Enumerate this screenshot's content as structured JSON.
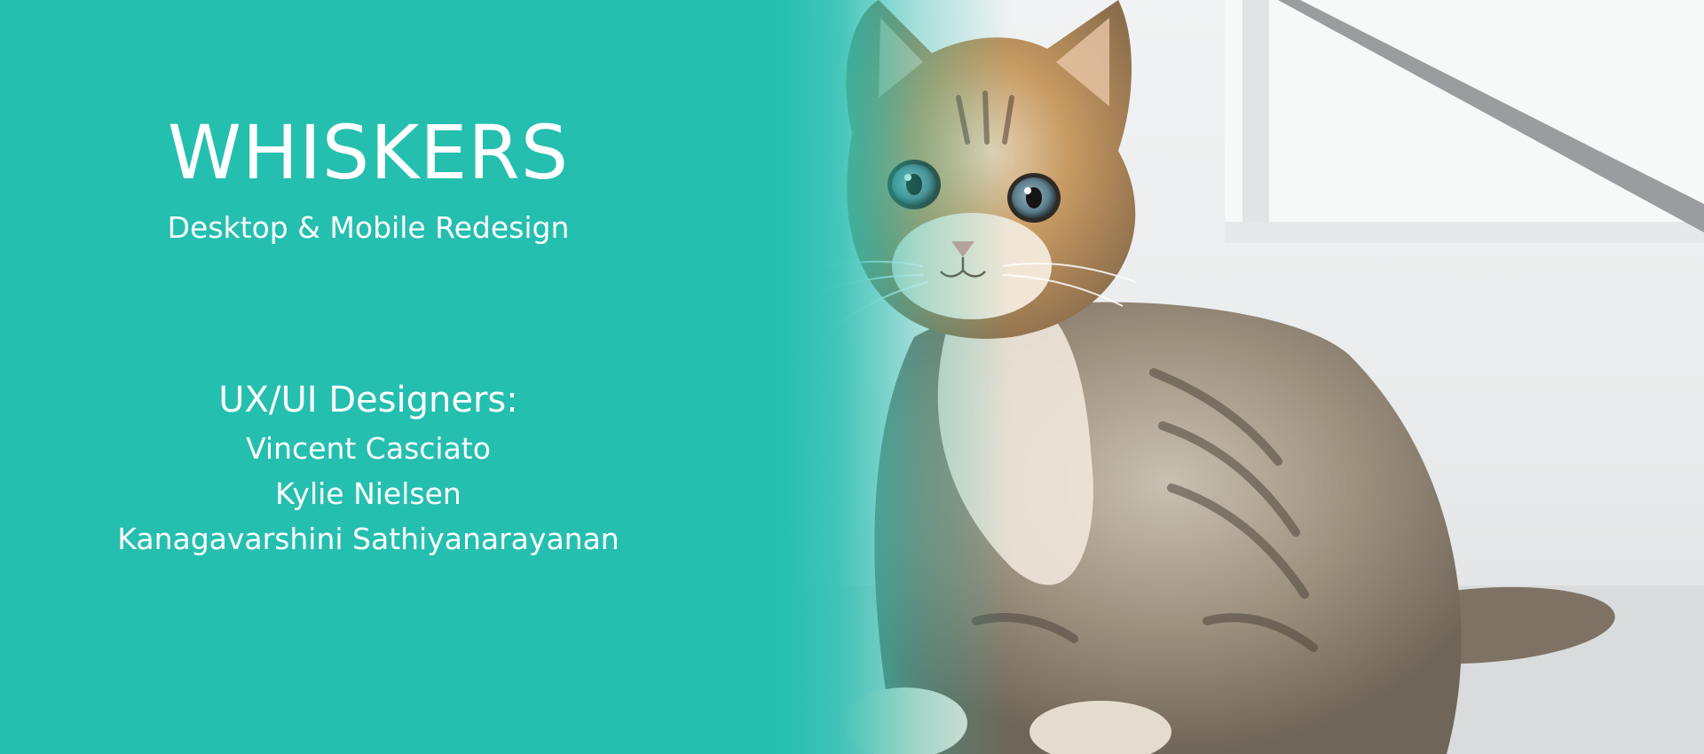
{
  "slide": {
    "title": "WHISKERS",
    "subtitle": "Desktop & Mobile Redesign",
    "designers_heading": "UX/UI Designers:",
    "designers": [
      "Vincent Casciato",
      "Kylie Nielsen",
      "Kanagavarshini Sathiyanarayanan"
    ]
  },
  "colors": {
    "background": "#25BFB0",
    "text": "#FFFFFF"
  }
}
